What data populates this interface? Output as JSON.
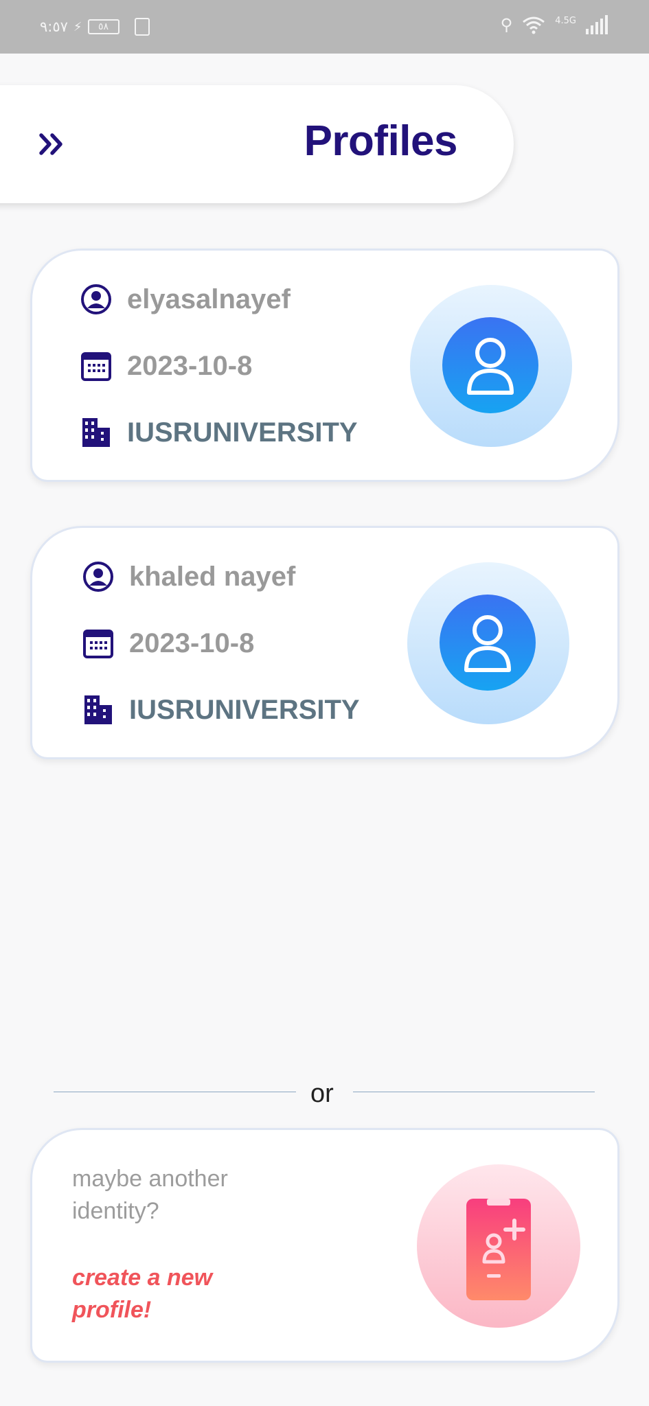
{
  "status_bar": {
    "time": "٩:٥٧",
    "battery": "٥٨",
    "network": "4.5G"
  },
  "header": {
    "title": "Profiles",
    "menu_icon": "double-chevron-right-icon"
  },
  "profiles": [
    {
      "name": "elyasalnayef",
      "date": "2023-10-8",
      "organization": "IUSRUNIVERSITY"
    },
    {
      "name": "khaled nayef",
      "date": "2023-10-8",
      "organization": "IUSRUNIVERSITY"
    }
  ],
  "divider": {
    "label": "or"
  },
  "create": {
    "prompt": "maybe another identity?",
    "cta": "create a new profile!"
  },
  "colors": {
    "title": "#22127a",
    "icon": "#22127a",
    "muted_text": "#999999",
    "org_text": "#5d7482",
    "cta": "#f0545a",
    "avatar_blue": "#3a73f2",
    "create_pink": "#fbb7c5"
  }
}
